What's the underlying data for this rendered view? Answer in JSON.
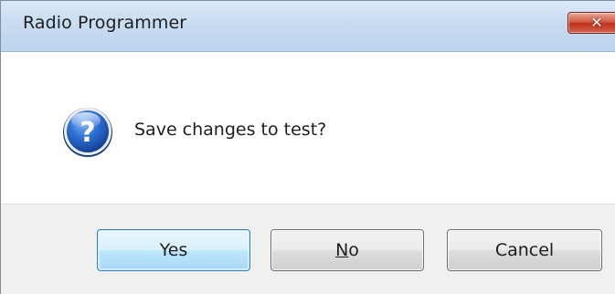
{
  "window": {
    "title": "Radio Programmer",
    "close_icon": "close-icon"
  },
  "dialog": {
    "icon": "question-icon",
    "message": "Save changes to test?"
  },
  "buttons": {
    "yes_label": "Yes",
    "no_mnemonic": "N",
    "no_rest": "o",
    "cancel_label": "Cancel"
  },
  "colors": {
    "titlebar": "#c9dcf1",
    "close_button": "#c0301a",
    "default_button_border": "#3c7fb1",
    "footer": "#f0f0f0",
    "question_icon": "#1f5fbf"
  }
}
